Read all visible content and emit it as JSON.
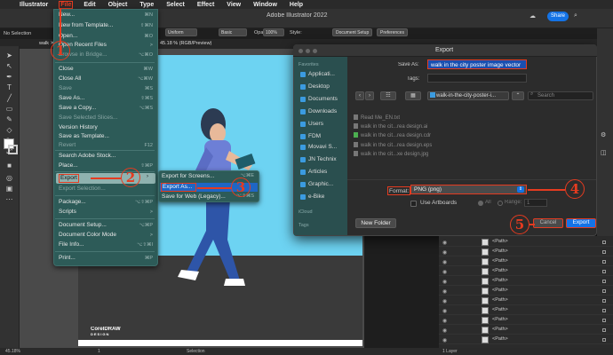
{
  "menubar": {
    "apple_glyph": "",
    "items": [
      "Illustrator",
      "File",
      "Edit",
      "Object",
      "Type",
      "Select",
      "Effect",
      "View",
      "Window",
      "Help"
    ]
  },
  "app": {
    "title": "Adobe Illustrator 2022",
    "share_label": "Share"
  },
  "controlbar": {
    "selection_label": "No Selection",
    "stroke_style": "Basic",
    "uniform_label": "Uniform",
    "opacity_label": "Opacity:",
    "opacity_value": "100%",
    "style_label": "Style:",
    "document_setup": "Document Setup",
    "preferences": "Preferences"
  },
  "document": {
    "tab_prefix": "walk",
    "tab_info": "45.18 % (RGB/Preview)",
    "zoom": "45.18%",
    "artboard_num": "1",
    "status_mode": "Selection",
    "layers_count": "1 Layer",
    "brand_line1": "CorelDRAW",
    "brand_line2": "DESIGN"
  },
  "file_menu": {
    "items": [
      {
        "label": "New...",
        "shortcut": "⌘N",
        "enabled": true
      },
      {
        "label": "New from Template...",
        "shortcut": "⇧⌘N",
        "enabled": true
      },
      {
        "label": "Open...",
        "shortcut": "⌘O",
        "enabled": true
      },
      {
        "label": "Open Recent Files",
        "shortcut": ">",
        "enabled": true
      },
      {
        "label": "Browse in Bridge...",
        "shortcut": "⌥⌘O",
        "enabled": false
      },
      {
        "label": "Close",
        "shortcut": "⌘W",
        "enabled": true
      },
      {
        "label": "Close All",
        "shortcut": "⌥⌘W",
        "enabled": true
      },
      {
        "label": "Save",
        "shortcut": "⌘S",
        "enabled": false
      },
      {
        "label": "Save As...",
        "shortcut": "⇧⌘S",
        "enabled": true
      },
      {
        "label": "Save a Copy...",
        "shortcut": "⌥⌘S",
        "enabled": true
      },
      {
        "label": "Save Selected Slices...",
        "shortcut": "",
        "enabled": false
      },
      {
        "label": "Version History",
        "shortcut": "",
        "enabled": true
      },
      {
        "label": "Save as Template...",
        "shortcut": "",
        "enabled": true
      },
      {
        "label": "Revert",
        "shortcut": "F12",
        "enabled": false
      },
      {
        "label": "Search Adobe Stock...",
        "shortcut": "",
        "enabled": true
      },
      {
        "label": "Place...",
        "shortcut": "⇧⌘P",
        "enabled": true
      },
      {
        "label": "Export",
        "shortcut": ">",
        "enabled": true
      },
      {
        "label": "Export Selection...",
        "shortcut": "",
        "enabled": false
      },
      {
        "label": "Package...",
        "shortcut": "⌥⇧⌘P",
        "enabled": true
      },
      {
        "label": "Scripts",
        "shortcut": ">",
        "enabled": true
      },
      {
        "label": "Document Setup...",
        "shortcut": "⌥⌘P",
        "enabled": true
      },
      {
        "label": "Document Color Mode",
        "shortcut": ">",
        "enabled": true
      },
      {
        "label": "File Info...",
        "shortcut": "⌥⇧⌘I",
        "enabled": true
      },
      {
        "label": "Print...",
        "shortcut": "⌘P",
        "enabled": true
      }
    ]
  },
  "export_submenu": {
    "items": [
      {
        "label": "Export for Screens...",
        "shortcut": "⌥⌘E"
      },
      {
        "label": "Export As...",
        "shortcut": ""
      },
      {
        "label": "Save for Web (Legacy)...",
        "shortcut": "⌥⇧⌘S"
      }
    ]
  },
  "export_dialog": {
    "title": "Export",
    "save_as_label": "Save As:",
    "save_as_value": "walk in the city poster image vector",
    "tags_label": "Tags:",
    "folder": "walk-in-the-city-poster-i...",
    "search_placeholder": "Search",
    "sidebar": {
      "favorites_heading": "Favorites",
      "favorites": [
        "Applicati...",
        "Desktop",
        "Documents",
        "Downloads",
        "Users",
        "FDM",
        "Movavi S...",
        "JN Technix",
        "Articles",
        "Graphic...",
        "e-Bike"
      ],
      "icloud_heading": "iCloud",
      "tags_heading": "Tags"
    },
    "files": [
      "Read Me_EN.txt",
      "walk in the cit...rea design.ai",
      "walk in the cit...rea design.cdr",
      "walk in the cit...rea design.eps",
      "walk in the cit...xe design.jpg"
    ],
    "format_label": "Format:",
    "format_value": "PNG (png)",
    "use_artboards_label": "Use Artboards",
    "all_label": "All",
    "range_label": "Range:",
    "range_value": "1",
    "new_folder_label": "New Folder",
    "cancel_label": "Cancel",
    "export_label": "Export"
  },
  "layers": {
    "rows": [
      "<Path>",
      "<Path>",
      "<Path>",
      "<Path>",
      "<Path>",
      "<Path>",
      "<Path>",
      "<Path>",
      "<Path>",
      "<Path>",
      "<Path>",
      "<Path>"
    ]
  },
  "steps": [
    "1",
    "2",
    "3",
    "4",
    "5"
  ],
  "colors": {
    "annotation_red": "#e53b20",
    "menu_teal": "#2d5b58",
    "accent_blue": "#1473e6",
    "sky": "#6dd3f2"
  }
}
